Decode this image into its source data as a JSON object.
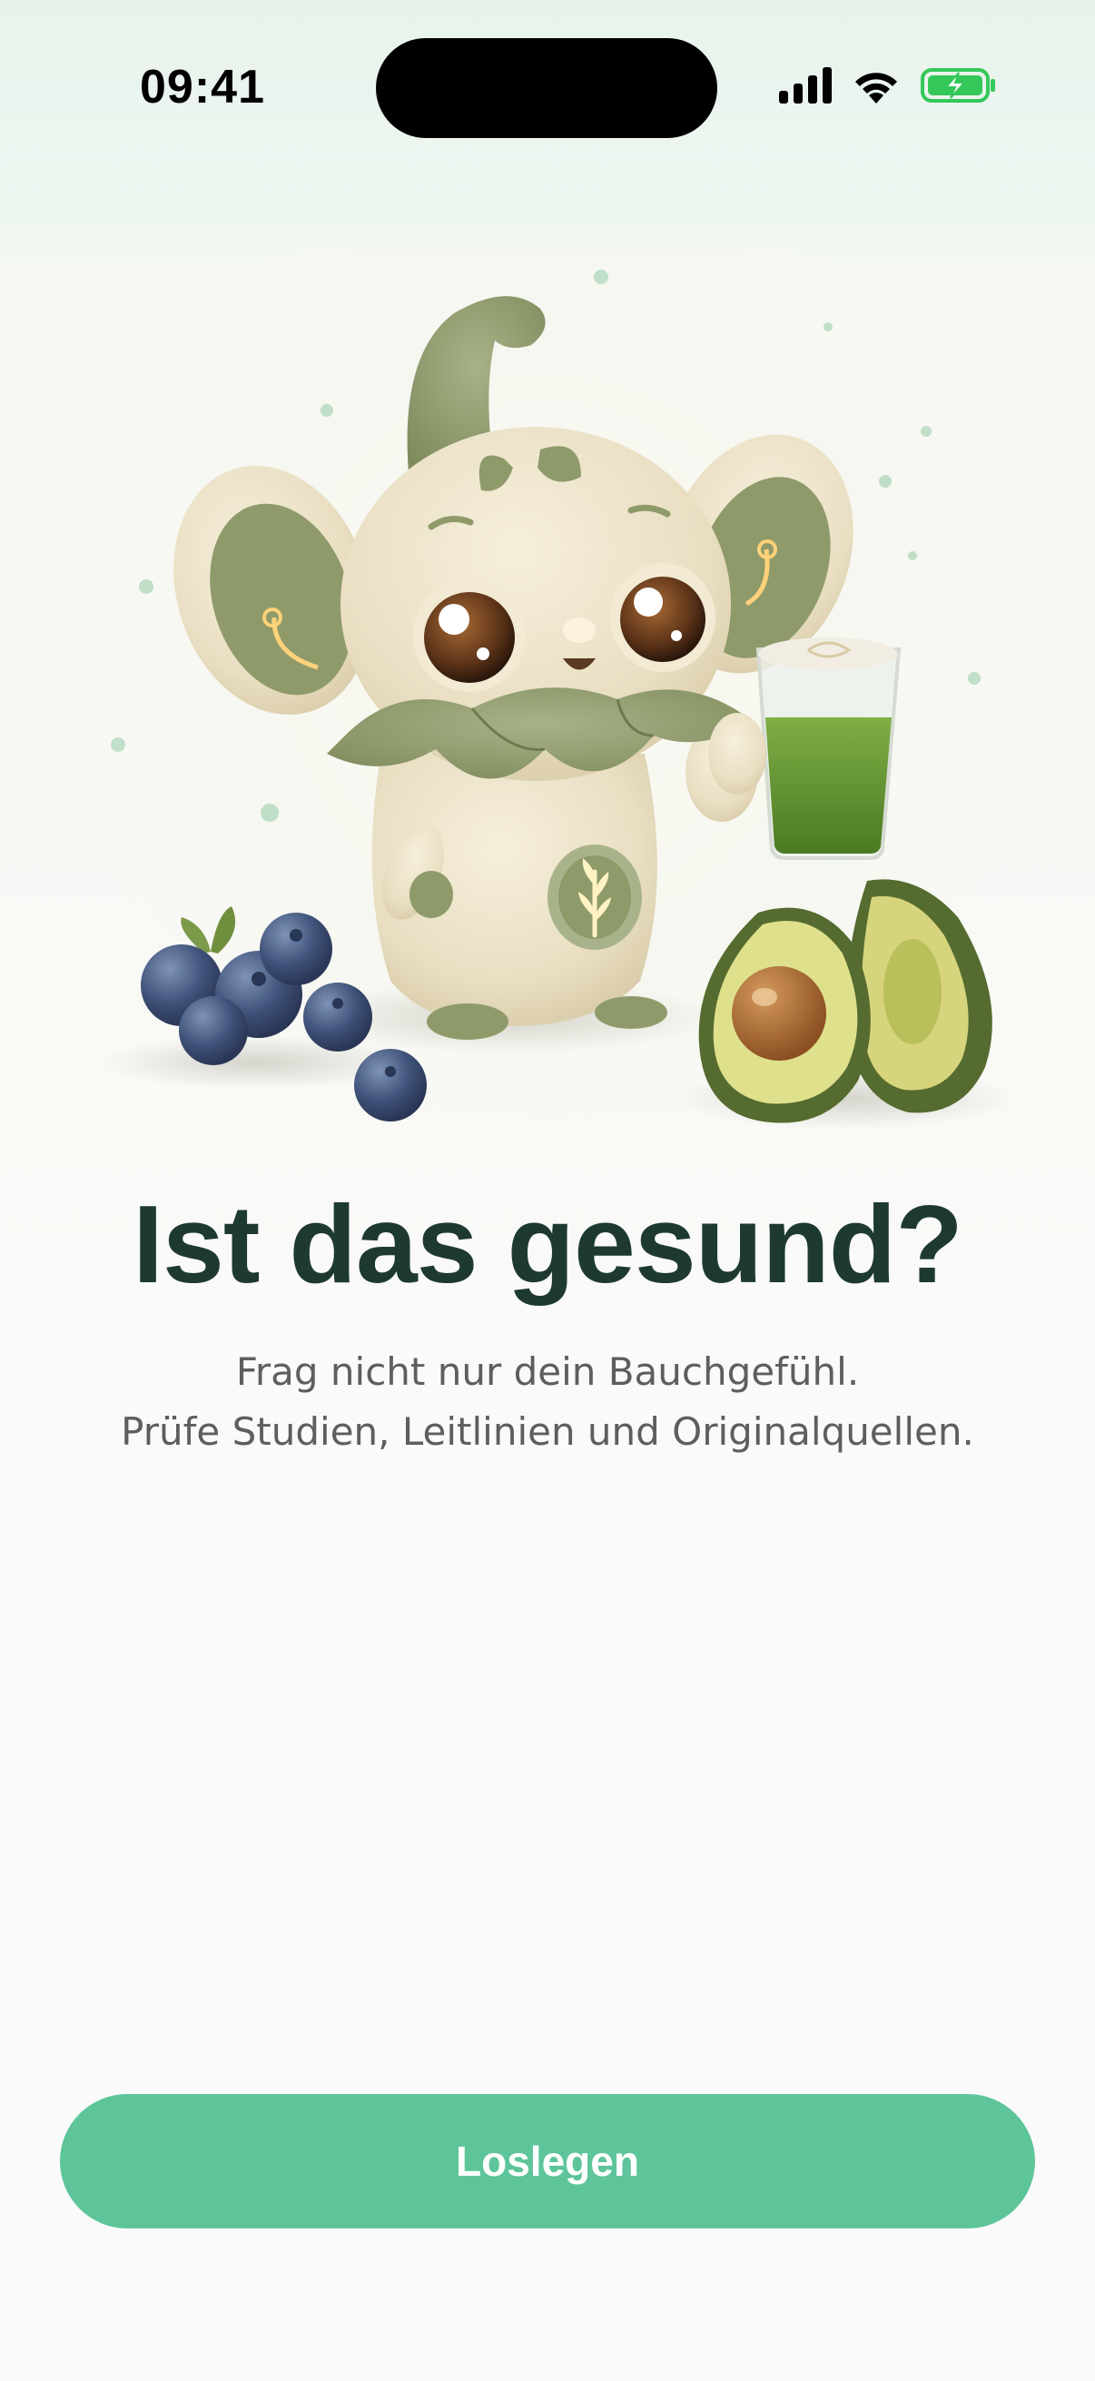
{
  "status_bar": {
    "time": "09:41",
    "icons": [
      "cellular-signal-icon",
      "wifi-icon",
      "battery-charging-icon"
    ],
    "battery_color": "#34c759"
  },
  "hero": {
    "illustration": "mascot-creature-with-matcha-glass-avocado-blueberries",
    "mascot_accent": "#8f9a6a"
  },
  "onboarding": {
    "title": "Ist das gesund?",
    "subtitle_line1": "Frag nicht nur dein Bauchgefühl.",
    "subtitle_line2": "Prüfe Studien, Leitlinien und Originalquellen."
  },
  "cta": {
    "label": "Loslegen",
    "color": "#5ec59a"
  }
}
